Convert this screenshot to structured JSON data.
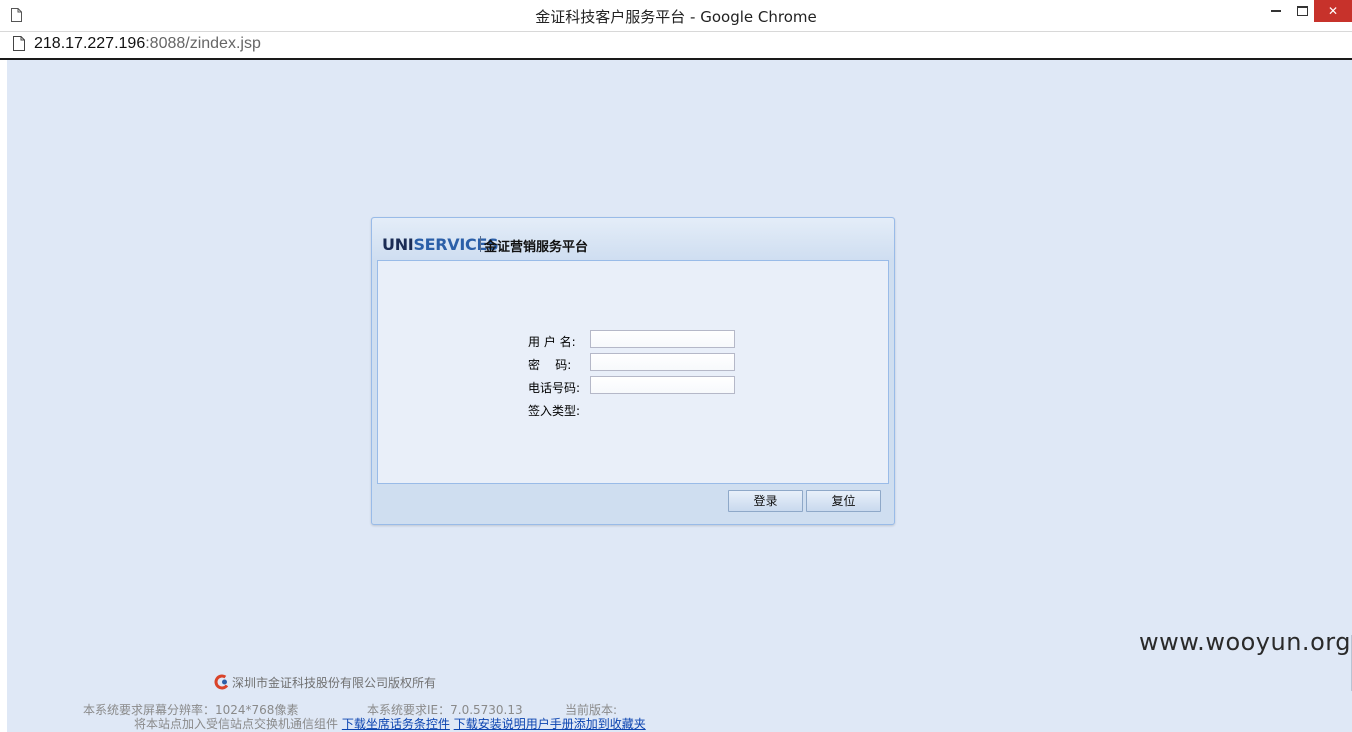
{
  "window": {
    "title": "金证科技客户服务平台 - Google Chrome",
    "icon": "document-icon",
    "controls": [
      "minimize-icon",
      "maximize-icon",
      "close-icon"
    ]
  },
  "address_bar": {
    "host": "218.17.227.196",
    "path": ":8088/zindex.jsp"
  },
  "login_panel": {
    "logo": {
      "uni": "UNI",
      "services": "SERVICES"
    },
    "platform_name": "金证营销服务平台",
    "fields": [
      {
        "label": "用 户 名:",
        "value": "",
        "placeholder": ""
      },
      {
        "label": "密    码:",
        "value": "",
        "placeholder": ""
      },
      {
        "label": "电话号码:",
        "value": "",
        "placeholder": ""
      },
      {
        "label": "签入类型:"
      }
    ],
    "buttons": {
      "login": "登录",
      "reset": "复位"
    }
  },
  "footer": {
    "copyright": "深圳市金证科技股份有限公司版权所有",
    "resolution": "本系统要求屏幕分辨率：1024*768像素",
    "ie": "本系统要求IE：7.0.5730.13",
    "version": "当前版本:",
    "trusted_sites": "将本站点加入受信站点交换机通信组件",
    "link_download_control": "下载坐席话务条控件",
    "link_download_manual": "下载安装说明用户手册",
    "link_add_favorite": "添加到收藏夹"
  },
  "watermark": "www.wooyun.org",
  "colors": {
    "page_background": "#dfe8f6",
    "panel_border": "#99bbe8",
    "link": "#0b43b0",
    "close_button": "#c7322b"
  }
}
